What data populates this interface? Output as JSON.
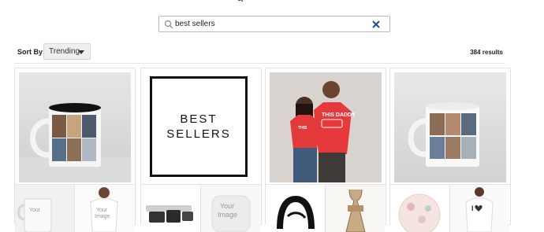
{
  "search": {
    "value": "best sellers",
    "placeholder": "",
    "icon": "search-icon",
    "clear_icon": "close-icon",
    "clear_color": "#1f4f8f"
  },
  "sort": {
    "label": "Sort By:",
    "selected": "Trending"
  },
  "results_text": "384 results",
  "products": [
    {
      "name": "Two-tone photo collage mug",
      "thumbs": [
        "mug-custom",
        "t-shirt-custom"
      ]
    },
    {
      "name": "Best sellers tile",
      "title_line1": "BEST",
      "title_line2": "SELLERS",
      "thumbs": [
        "cookware-set",
        "pillow-custom"
      ]
    },
    {
      "name": "Couple red t-shirts",
      "shirt_text": "THIS DADDY",
      "thumbs": [
        "trucker-hat",
        "apron"
      ]
    },
    {
      "name": "Photo collage mug",
      "thumbs": [
        "floral-plate",
        "i-heart-t-shirt"
      ]
    }
  ],
  "thumb_text": {
    "your_image": "Your Image",
    "i_heart": "I"
  }
}
